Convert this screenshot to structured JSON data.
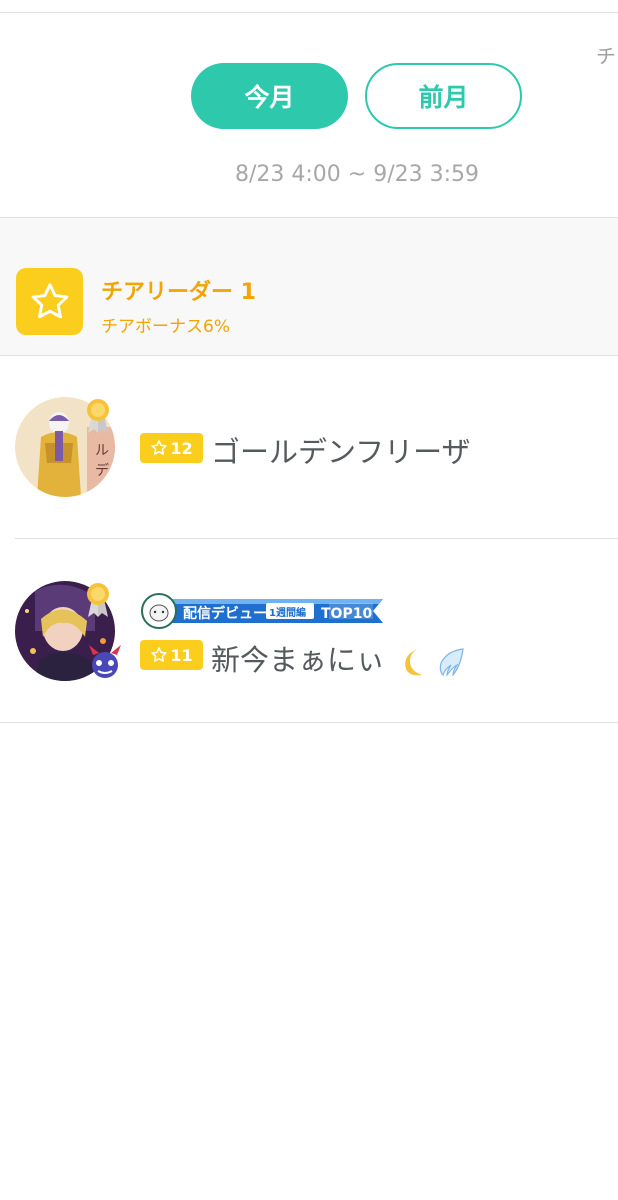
{
  "edge_text": "チ",
  "tabs": {
    "current_month": "今月",
    "previous_month": "前月"
  },
  "date_range": "8/23 4:00 ~ 9/23 3:59",
  "rank": {
    "title": "チアリーダー 1",
    "bonus": "チアボーナス6%",
    "icon": "star-icon"
  },
  "users": [
    {
      "level": "12",
      "name": "ゴールデンフリーザ",
      "badge": null
    },
    {
      "level": "11",
      "name": "新今まぁにぃ",
      "badge": {
        "main": "配信デビュー",
        "period": "1週間編",
        "rank": "TOP10"
      },
      "emojis": [
        "crescent-moon-icon",
        "wing-icon"
      ]
    }
  ],
  "colors": {
    "accent": "#2ec9ad",
    "gold": "#fbcd1c",
    "rank_text": "#f2a400",
    "username": "#555a5d",
    "date_text": "#a7a7a7"
  }
}
